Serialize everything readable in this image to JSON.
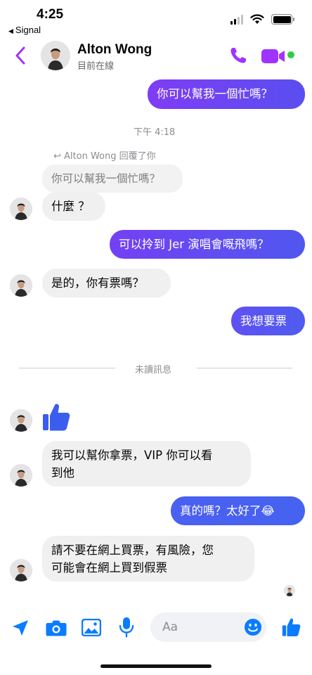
{
  "status_bar": {
    "time": "4:25",
    "back_app": "Signal",
    "icons": [
      "cellular-signal-icon",
      "wifi-icon",
      "battery-icon"
    ]
  },
  "header": {
    "contact_name": "Alton Wong",
    "presence": "目前在線",
    "icons": [
      "back-chevron-icon",
      "phone-icon",
      "video-camera-icon"
    ],
    "accent_color": "#a033ff",
    "online_color": "#31cc46"
  },
  "messages": {
    "out_1": "你可以幫我一個忙嗎？",
    "timestamp": "下午 4:18",
    "reply_meta": "Alton Wong 回覆了你",
    "reply_quote": "你可以幫我一個忙嗎？",
    "in_1": "什麼 ？",
    "out_2": "可以拎到 Jer 演唱會嘅飛嗎？",
    "in_2": "是的，你有票嗎？",
    "out_3": "我想要票",
    "unread_divider": "未讀訊息",
    "in_like": "thumbs-up-icon",
    "in_3_line1": "我可以幫你拿票，VIP 你可以看",
    "in_3_line2": "到他",
    "out_4": "真的嗎？太好了",
    "out_4_emoji": "😂",
    "in_4_line1": "請不要在網上買票，有風險，您",
    "in_4_line2": "可能會在網上買到假票"
  },
  "bubble_colors": {
    "outgoing_gradient": [
      "#7f3cf5",
      "#4f5df0"
    ],
    "incoming": "#f0f0f0"
  },
  "composer": {
    "placeholder": "Aa",
    "icons": [
      "location-arrow-icon",
      "camera-icon",
      "gallery-icon",
      "microphone-icon",
      "emoji-icon",
      "thumbs-up-icon"
    ],
    "icon_color": "#0a7cff"
  }
}
